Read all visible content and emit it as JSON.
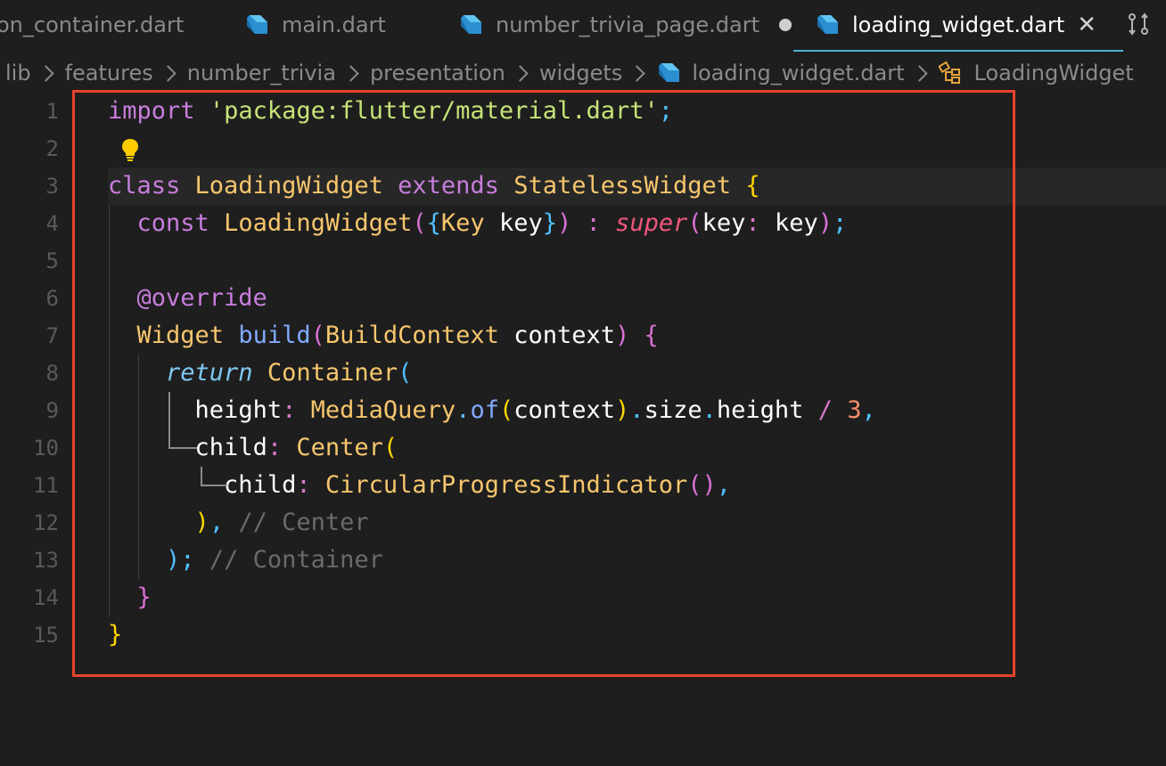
{
  "tabs": [
    {
      "label": "on_container.dart",
      "active": false
    },
    {
      "label": "main.dart",
      "active": false
    },
    {
      "label": "number_trivia_page.dart",
      "active": false,
      "unsaved": true
    },
    {
      "label": "loading_widget.dart",
      "active": true
    }
  ],
  "breadcrumb": [
    "lib",
    "features",
    "number_trivia",
    "presentation",
    "widgets",
    "loading_widget.dart",
    "LoadingWidget"
  ],
  "line_numbers": [
    "1",
    "2",
    "3",
    "4",
    "5",
    "6",
    "7",
    "8",
    "9",
    "10",
    "11",
    "12",
    "13",
    "14",
    "15"
  ],
  "code": {
    "l1": {
      "kw": "import",
      "str": "'package:flutter/material.dart'",
      "end": ";"
    },
    "l3": {
      "kw1": "class",
      "name": "LoadingWidget",
      "kw2": "extends",
      "base": "StatelessWidget",
      "brace": "{"
    },
    "l4": {
      "kw": "const",
      "name": "LoadingWidget",
      "p1": "(",
      "b1": "{",
      "type": "Key",
      "param": "key",
      "b2": "}",
      "p2": ")",
      "colon": ":",
      "sup": "super",
      "p3": "(",
      "arg": "key",
      "c2": ":",
      "val": "key",
      "p4": ")",
      "end": ";"
    },
    "l6": {
      "text": "@override"
    },
    "l7": {
      "type": "Widget",
      "fn": "build",
      "p1": "(",
      "ptype": "BuildContext",
      "pname": "context",
      "p2": ")",
      "brace": "{"
    },
    "l8": {
      "kw": "return",
      "name": "Container",
      "p": "("
    },
    "l9": {
      "prop": "height",
      "colon": ":",
      "cls": "MediaQuery",
      "dot1": ".",
      "fn": "of",
      "p1": "(",
      "arg": "context",
      "p2": ")",
      "dot2": ".",
      "prop2": "size",
      "dot3": ".",
      "prop3": "height",
      "op": "/",
      "num": "3",
      "comma": ","
    },
    "l10": {
      "prop": "child",
      "colon": ":",
      "cls": "Center",
      "p": "("
    },
    "l11": {
      "prop": "child",
      "colon": ":",
      "cls": "CircularProgressIndicator",
      "p": "()",
      "comma": ","
    },
    "l12": {
      "p": ")",
      "comma": ",",
      "comment": "// Center"
    },
    "l13": {
      "p": ")",
      "semi": ";",
      "comment": "// Container"
    },
    "l14": {
      "brace": "}"
    },
    "l15": {
      "brace": "}"
    }
  },
  "colors": {
    "background": "#1e1e1e",
    "highlight_border": "#e8432c",
    "active_tab_underline": "#4fb2d8"
  },
  "icons": {
    "file": "dart-file-icon",
    "symbol": "class-symbol-icon",
    "hint": "lightbulb-icon",
    "compare": "compare-changes-icon",
    "close": "close-icon"
  }
}
